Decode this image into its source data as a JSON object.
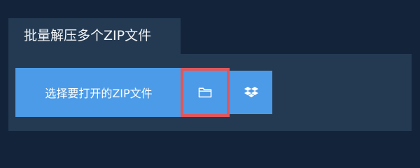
{
  "tab": {
    "title": "批量解压多个ZIP文件"
  },
  "toolbar": {
    "open_button_label": "选择要打开的ZIP文件",
    "folder_icon": "folder-icon",
    "dropbox_icon": "dropbox-icon"
  },
  "colors": {
    "page_background": "#13243a",
    "panel_background": "#243a52",
    "button_blue": "#4b9be8",
    "highlight_border": "#e0575b"
  }
}
